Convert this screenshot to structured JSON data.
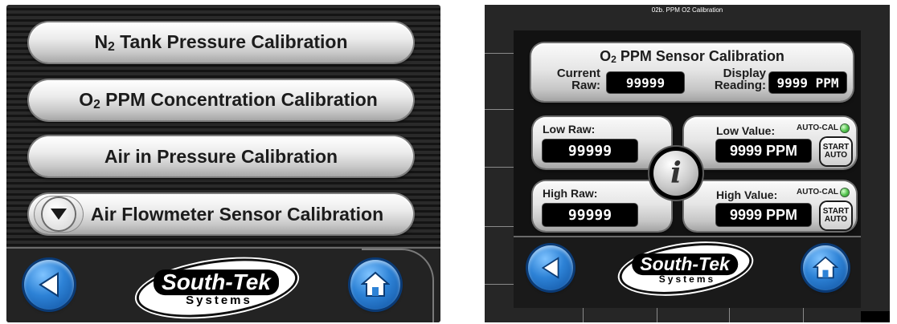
{
  "left": {
    "buttons": [
      {
        "pre": "N",
        "sub": "2",
        "post": " Tank Pressure Calibration"
      },
      {
        "pre": "O",
        "sub": "2",
        "post": " PPM Concentration Calibration"
      },
      {
        "pre": "Air in Pressure Calibration",
        "sub": "",
        "post": ""
      },
      {
        "pre": "Air Flowmeter Sensor Calibration",
        "sub": "",
        "post": ""
      }
    ],
    "logo": {
      "main": "South-Tek",
      "sub": "Systems"
    }
  },
  "right": {
    "window_title": "02b. PPM O2 Calibration",
    "header": {
      "title_pre": "O",
      "title_sub": "2",
      "title_post": " PPM Sensor Calibration",
      "current_raw_label_1": "Current",
      "current_raw_label_2": "Raw:",
      "current_raw_value": "99999",
      "display_label_1": "Display",
      "display_label_2": "Reading:",
      "display_value": "9999 PPM"
    },
    "low": {
      "raw_label": "Low Raw:",
      "raw_value": "99999",
      "value_label": "Low Value:",
      "value": "9999 PPM",
      "autocal_label": "AUTO-CAL",
      "start_1": "START",
      "start_2": "AUTO"
    },
    "high": {
      "raw_label": "High Raw:",
      "raw_value": "99999",
      "value_label": "High Value:",
      "value": "9999 PPM",
      "autocal_label": "AUTO-CAL",
      "start_1": "START",
      "start_2": "AUTO"
    },
    "info_glyph": "i",
    "logo": {
      "main": "South-Tek",
      "sub": "Systems"
    }
  },
  "icons": {
    "back": "back-arrow-icon",
    "home": "home-icon",
    "down": "chevron-down-icon",
    "info": "info-icon",
    "status": "status-led-icon"
  },
  "colors": {
    "button_blue": "#2d82d6",
    "led_green": "#4fc24a",
    "panel_dark": "#1a1a1a"
  }
}
